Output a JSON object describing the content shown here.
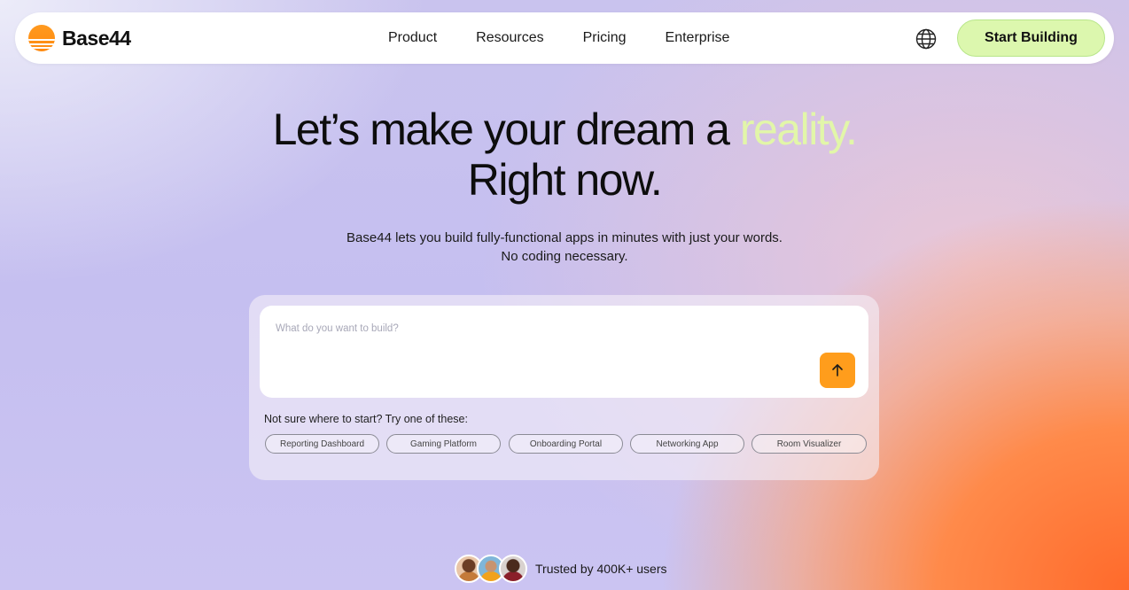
{
  "brand": {
    "name": "Base44",
    "accent": "#ff9a1f"
  },
  "nav": {
    "links": [
      "Product",
      "Resources",
      "Pricing",
      "Enterprise"
    ],
    "cta_label": "Start Building",
    "cta_color": "#dcf7ae"
  },
  "hero": {
    "line1_prefix": "Let’s make your dream a ",
    "line1_accent": "reality.",
    "line2": "Right now.",
    "sub1": "Base44 lets you build fully-functional apps in minutes with just your words.",
    "sub2": "No coding necessary."
  },
  "prompt": {
    "placeholder": "What do you want to build?",
    "value": "",
    "suggest_label": "Not sure where to start? Try one of these:",
    "suggestions": [
      "Reporting Dashboard",
      "Gaming Platform",
      "Onboarding Portal",
      "Networking App",
      "Room Visualizer"
    ]
  },
  "trust": {
    "text": "Trusted by 400K+ users"
  }
}
